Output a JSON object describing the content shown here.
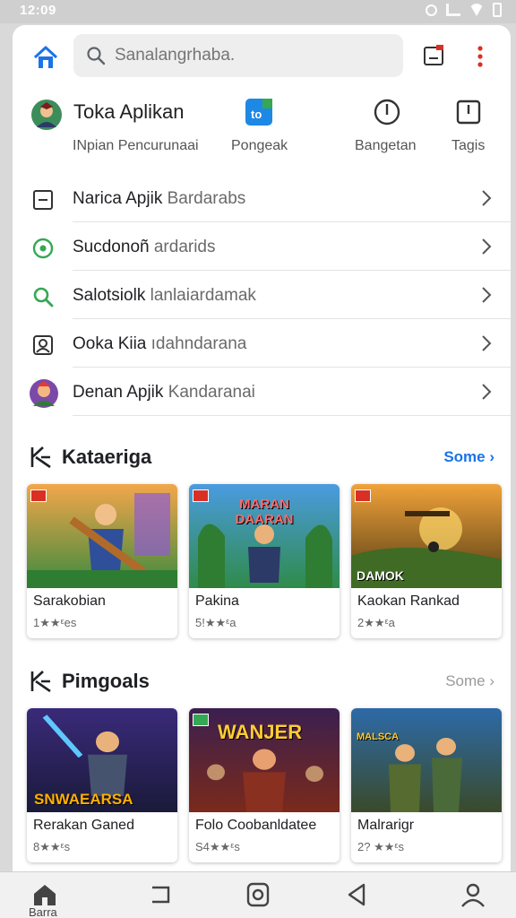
{
  "status_bar": {
    "time": "12:09"
  },
  "top_bar": {
    "search_placeholder": "Sanalangrhaba."
  },
  "shortcuts": {
    "app_title": "Toka Aplikan",
    "items": [
      {
        "label": "INpian Pencurunaai"
      },
      {
        "label": "Pongeak"
      },
      {
        "label": "Bangetan"
      },
      {
        "label": "Tagis"
      }
    ]
  },
  "list": [
    {
      "title": "Narica Apjik",
      "subtitle": "Bardarabs",
      "icon": "square-icon"
    },
    {
      "title": "Sucdonoñ",
      "subtitle": "ardarids",
      "icon": "whatsapp-icon"
    },
    {
      "title": "Salotsiolk",
      "subtitle": "lanlaiardamak",
      "icon": "search-icon"
    },
    {
      "title": "Ooka Kiia",
      "subtitle": "ıdahndarana",
      "icon": "image-icon"
    },
    {
      "title": "Denan Apjik",
      "subtitle": "Kandaranai",
      "icon": "game-avatar-icon"
    }
  ],
  "sections": [
    {
      "title": "Kataeriga",
      "more": "Some",
      "tiles": [
        {
          "name": "Sarakobian",
          "rating": "1★★ᵋes",
          "art_text": ""
        },
        {
          "name": "Pakina",
          "rating": "5!★★ᵋa",
          "art_text": "MARAN DAARAN"
        },
        {
          "name": "Kaokan Rankad",
          "rating": "2★★ᵋa",
          "art_text": "DAMOK"
        }
      ]
    },
    {
      "title": "Pimgoals",
      "more": "Some",
      "tiles": [
        {
          "name": "Rerakan Ganed",
          "rating": "8★★ᵋs",
          "art_text": "SNWAEARSA"
        },
        {
          "name": "Folo Coobanldatee",
          "rating": "S4★★ᵋs",
          "art_text": "WANJER"
        },
        {
          "name": "Malrarigr",
          "rating": "2? ★★ᵋs",
          "art_text": "MALSCA"
        }
      ]
    }
  ],
  "bottom_nav": {
    "home_label": "Barra"
  },
  "colors": {
    "accent": "#1a73e8",
    "star": "#f5b400",
    "badge": "#d93025"
  }
}
